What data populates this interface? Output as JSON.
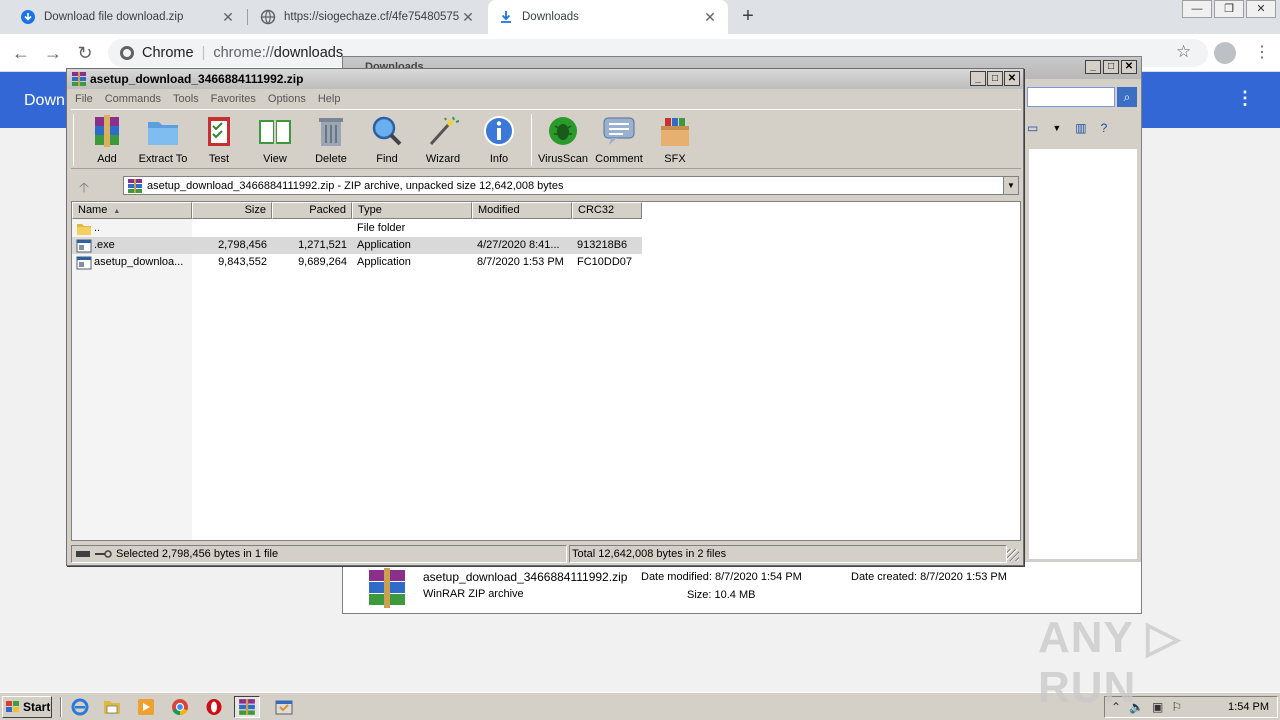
{
  "browser": {
    "tabs": [
      {
        "label": "Download file download.zip",
        "icon": "download-circle-icon"
      },
      {
        "label": "https://siogechaze.cf/4fe75480575",
        "icon": "globe-icon"
      },
      {
        "label": "Downloads",
        "icon": "download-arrow-icon"
      }
    ],
    "omnibox": {
      "chip": "Chrome",
      "scheme": "chrome://",
      "host": "downloads"
    },
    "page_title": "Downl"
  },
  "explorer": {
    "title": "Downloads",
    "details": {
      "filename": "asetup_download_3466884111992.zip",
      "type": "WinRAR ZIP archive",
      "date_modified": "Date modified: 8/7/2020 1:54 PM",
      "size": "Size: 10.4 MB",
      "date_created": "Date created: 8/7/2020 1:53 PM"
    }
  },
  "winrar": {
    "title": "asetup_download_3466884111992.zip",
    "menu": [
      "File",
      "Commands",
      "Tools",
      "Favorites",
      "Options",
      "Help"
    ],
    "tools": [
      {
        "label": "Add",
        "icon": "add-archive-icon"
      },
      {
        "label": "Extract To",
        "icon": "extract-folder-icon"
      },
      {
        "label": "Test",
        "icon": "test-clipboard-icon"
      },
      {
        "label": "View",
        "icon": "view-book-icon"
      },
      {
        "label": "Delete",
        "icon": "trash-icon"
      },
      {
        "label": "Find",
        "icon": "magnifier-icon"
      },
      {
        "label": "Wizard",
        "icon": "wand-icon"
      },
      {
        "label": "Info",
        "icon": "info-icon"
      },
      {
        "label": "VirusScan",
        "icon": "bug-icon"
      },
      {
        "label": "Comment",
        "icon": "comment-icon"
      },
      {
        "label": "SFX",
        "icon": "sfx-box-icon"
      }
    ],
    "path": "asetup_download_3466884111992.zip - ZIP archive, unpacked size 12,642,008 bytes",
    "columns": [
      "Name",
      "Size",
      "Packed",
      "Type",
      "Modified",
      "CRC32"
    ],
    "rows": [
      {
        "name": "..",
        "size": "",
        "packed": "",
        "type": "File folder",
        "modified": "",
        "crc": "",
        "icon": "folder-icon"
      },
      {
        "name": ".exe",
        "size": "2,798,456",
        "packed": "1,271,521",
        "type": "Application",
        "modified": "4/27/2020 8:41...",
        "crc": "913218B6",
        "icon": "exe-icon",
        "selected": true
      },
      {
        "name": "asetup_downloa...",
        "size": "9,843,552",
        "packed": "9,689,264",
        "type": "Application",
        "modified": "8/7/2020 1:53 PM",
        "crc": "FC10DD07",
        "icon": "exe-icon"
      }
    ],
    "status_left": "Selected 2,798,456 bytes in 1 file",
    "status_right": "Total 12,642,008 bytes in 2 files"
  },
  "taskbar": {
    "start": "Start",
    "apps": [
      "ie-icon",
      "explorer-icon",
      "media-player-icon",
      "chrome-icon",
      "opera-icon",
      "winrar-icon",
      "program-icon"
    ],
    "clock": "1:54 PM"
  },
  "watermark": "ANY RUN",
  "colors": {
    "chrome_blue": "#3367d6",
    "win_face": "#d4d0c8",
    "selection": "#d9d9d9"
  }
}
